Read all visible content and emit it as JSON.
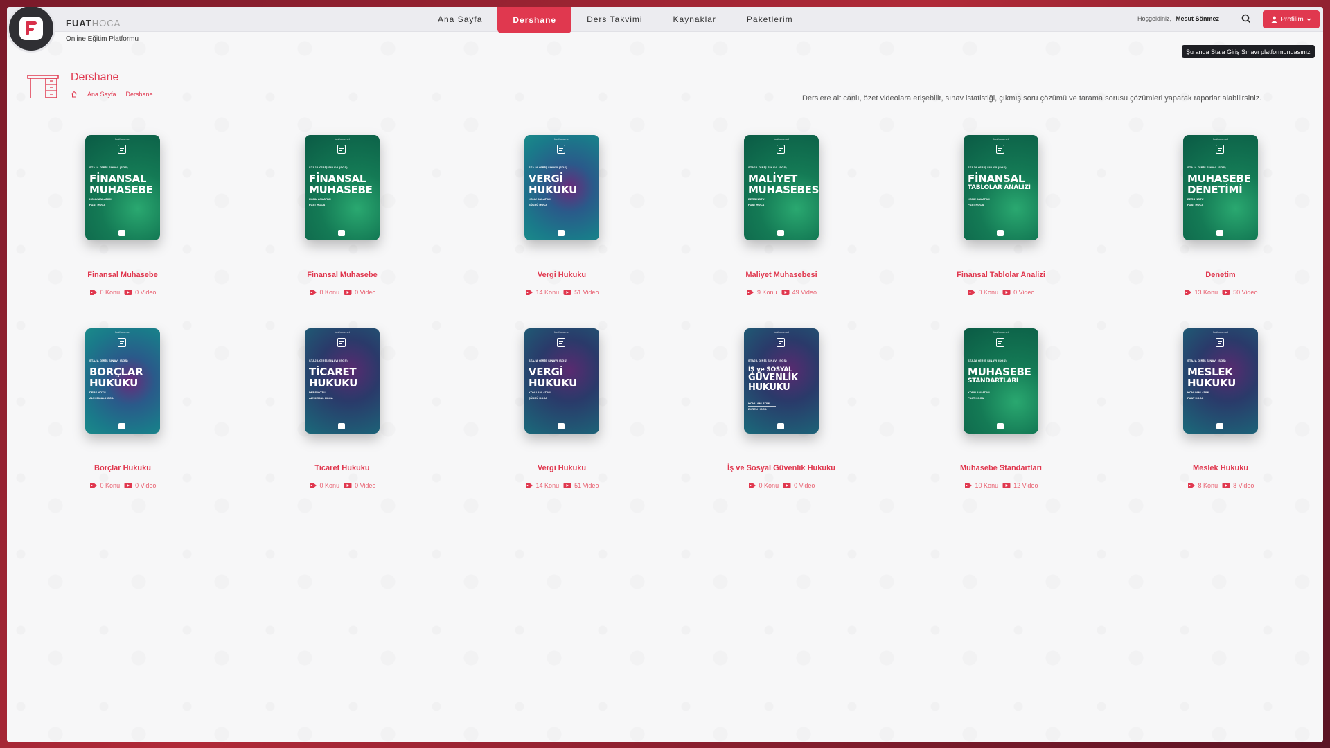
{
  "header": {
    "brand_bold": "FUAT",
    "brand_light": "HOCA",
    "tagline": "Online Eğitim Platformu",
    "nav": [
      {
        "label": "Ana Sayfa",
        "active": false
      },
      {
        "label": "Dershane",
        "active": true
      },
      {
        "label": "Ders Takvimi",
        "active": false
      },
      {
        "label": "Kaynaklar",
        "active": false
      },
      {
        "label": "Paketlerim",
        "active": false
      }
    ],
    "welcome": "Hoşgeldiniz,",
    "user_name": "Mesut Sönmez",
    "profile_label": "Profilim",
    "tooltip": "Şu anda Staja Giriş Sınavı platformundasınız"
  },
  "page": {
    "title": "Dershane",
    "breadcrumb": [
      "Ana Sayfa",
      "Dershane"
    ],
    "description": "Derslere ait canlı, özet videolara erişebilir, sınav istatistiği, çıkmış soru çözümü ve tarama sorusu çözümleri yaparak raporlar alabilirsiniz."
  },
  "cover_common": {
    "site": "fuathoca.net",
    "exam": "STAJA GİRİŞ SINAVI (SGS)"
  },
  "courses": [
    {
      "title": "Finansal Muhasebe",
      "cover_title": [
        "FİNANSAL",
        "MUHASEBE"
      ],
      "cover_type": "KONU ANLATIMI",
      "cover_author": "FUAT HOCA",
      "theme": "green",
      "konu": "0 Konu",
      "video": "0 Video"
    },
    {
      "title": "Finansal Muhasebe",
      "cover_title": [
        "FİNANSAL",
        "MUHASEBE"
      ],
      "cover_type": "KONU ANLATIMI",
      "cover_author": "FUAT HOCA",
      "theme": "green",
      "konu": "0 Konu",
      "video": "0 Video"
    },
    {
      "title": "Vergi Hukuku",
      "cover_title": [
        "VERGİ",
        "HUKUKU"
      ],
      "cover_type": "KONU ANLATIMI",
      "cover_author": "ŞÜKRÜ HOCA",
      "theme": "teal",
      "konu": "14 Konu",
      "video": "51 Video"
    },
    {
      "title": "Maliyet Muhasebesi",
      "cover_title": [
        "MALİYET",
        "MUHASEBESİ"
      ],
      "cover_type": "DERS NOTU",
      "cover_author": "FUAT HOCA",
      "theme": "green",
      "konu": "9 Konu",
      "video": "49 Video"
    },
    {
      "title": "Finansal Tablolar Analizi",
      "cover_title": [
        "FİNANSAL",
        "TABLOLAR ANALİZİ"
      ],
      "cover_type": "KONU ANLATIMI",
      "cover_author": "FUAT HOCA",
      "theme": "green",
      "konu": "0 Konu",
      "video": "0 Video"
    },
    {
      "title": "Denetim",
      "cover_title": [
        "MUHASEBE",
        "DENETİMİ"
      ],
      "cover_type": "DERS NOTU",
      "cover_author": "FUAT HOCA",
      "theme": "green",
      "konu": "13 Konu",
      "video": "50 Video"
    },
    {
      "title": "Borçlar Hukuku",
      "cover_title": [
        "BORÇLAR",
        "HUKUKU"
      ],
      "cover_type": "DERS NOTU",
      "cover_author": "ALİ KEMAL HOCA",
      "theme": "teal",
      "konu": "0 Konu",
      "video": "0 Video"
    },
    {
      "title": "Ticaret Hukuku",
      "cover_title": [
        "TİCARET",
        "HUKUKU"
      ],
      "cover_type": "DERS NOTU",
      "cover_author": "ALİ KEMAL HOCA",
      "theme": "dark",
      "konu": "0 Konu",
      "video": "0 Video"
    },
    {
      "title": "Vergi Hukuku",
      "cover_title": [
        "VERGİ",
        "HUKUKU"
      ],
      "cover_type": "KONU ANLATIMI",
      "cover_author": "ŞÜKRÜ HOCA",
      "theme": "dark",
      "konu": "14 Konu",
      "video": "51 Video"
    },
    {
      "title": "İş ve Sosyal Güvenlik Hukuku",
      "cover_title": [
        "İŞ ve SOSYAL",
        "GÜVENLİK",
        "HUKUKU"
      ],
      "cover_type": "KONU ANLATIMI",
      "cover_author": "EVREN HOCA",
      "theme": "dark",
      "konu": "0 Konu",
      "video": "0 Video"
    },
    {
      "title": "Muhasebe Standartları",
      "cover_title": [
        "MUHASEBE",
        "STANDARTLARI"
      ],
      "cover_type": "KONU ANLATIMI",
      "cover_author": "FUAT HOCA",
      "theme": "green",
      "konu": "10 Konu",
      "video": "12 Video"
    },
    {
      "title": "Meslek Hukuku",
      "cover_title": [
        "MESLEK",
        "HUKUKU"
      ],
      "cover_type": "KONU ANLATIMI",
      "cover_author": "FUAT HOCA",
      "theme": "dark",
      "konu": "8 Konu",
      "video": "8 Video"
    }
  ]
}
